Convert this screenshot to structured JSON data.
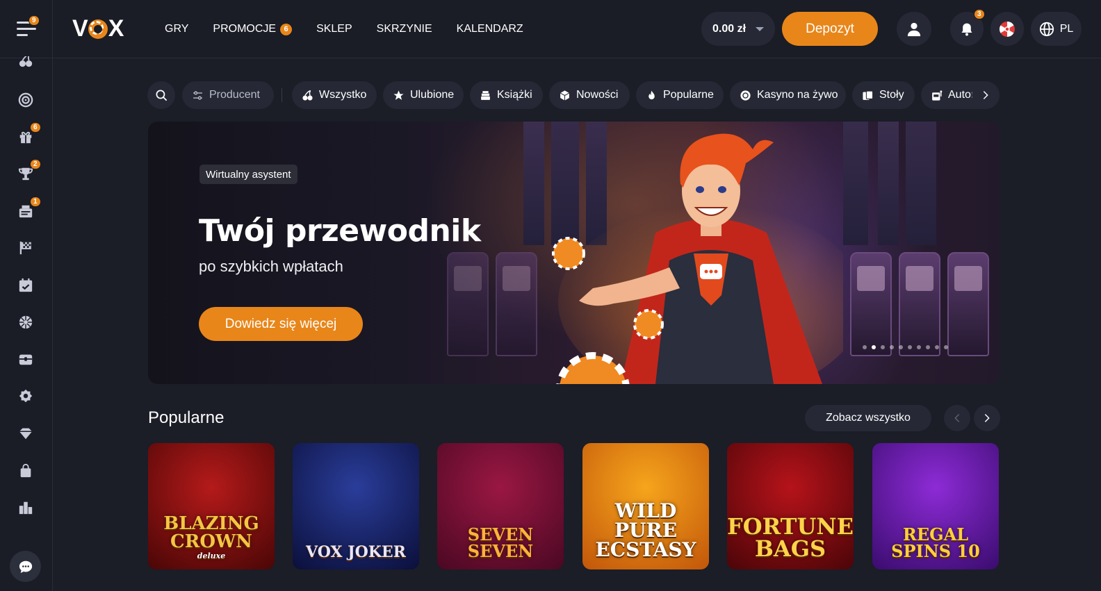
{
  "header": {
    "menu_badge": "9",
    "logo": "VOX",
    "nav": [
      {
        "label": "GRY"
      },
      {
        "label": "PROMOCJE",
        "badge": "6"
      },
      {
        "label": "SKLEP"
      },
      {
        "label": "SKRZYNIE"
      },
      {
        "label": "KALENDARZ"
      }
    ],
    "balance": "0.00 zł",
    "deposit_label": "Depozyt",
    "notifications_badge": "3",
    "language": "PL"
  },
  "sidebar": {
    "items": [
      {
        "icon": "cherries-icon"
      },
      {
        "icon": "target-icon"
      },
      {
        "icon": "gift-icon",
        "badge": "6"
      },
      {
        "icon": "trophy-icon",
        "badge": "2"
      },
      {
        "icon": "ticket-icon",
        "badge": "1"
      },
      {
        "icon": "race-flag-icon"
      },
      {
        "icon": "calendar-icon"
      },
      {
        "icon": "wheel-icon"
      },
      {
        "icon": "chest-icon"
      },
      {
        "icon": "badge-icon"
      },
      {
        "icon": "diamond-icon"
      },
      {
        "icon": "shopping-bag-icon"
      },
      {
        "icon": "leaderboard-icon"
      }
    ],
    "chat_icon": "chat-icon"
  },
  "filters": {
    "producer_label": "Producent",
    "chips": [
      {
        "label": "Wszystko",
        "icon": "cherries-icon"
      },
      {
        "label": "Ulubione",
        "icon": "star-icon"
      },
      {
        "label": "Książki",
        "icon": "books-icon"
      },
      {
        "label": "Nowości",
        "icon": "cube-icon"
      },
      {
        "label": "Popularne",
        "icon": "flame-icon"
      },
      {
        "label": "Kasyno na żywo",
        "icon": "chip-icon"
      },
      {
        "label": "Stoły",
        "icon": "cards-icon"
      },
      {
        "label": "Autor",
        "icon": "slot-icon"
      }
    ]
  },
  "hero": {
    "tag": "Wirtualny asystent",
    "title": "Twój przewodnik",
    "subtitle": "po szybkich wpłatach",
    "cta": "Dowiedz się więcej",
    "slide_count": 10,
    "active_slide": 2
  },
  "popular": {
    "title": "Popularne",
    "see_all": "Zobacz wszystko",
    "games": [
      {
        "name": "BLAZING CROWN",
        "sub": "deluxe",
        "bg1": "#b51a1a",
        "bg2": "#4a0606",
        "color": "#f5c542"
      },
      {
        "name": "VOX JOKER",
        "sub": "",
        "bg1": "#2a3d9a",
        "bg2": "#0b0f3a",
        "color": "#e9e6ff"
      },
      {
        "name": "SEVEN SEVEN",
        "sub": "",
        "bg1": "#9a1743",
        "bg2": "#4a0822",
        "color": "#ffb23a"
      },
      {
        "name": "WILD PURE ECSTASY",
        "sub": "",
        "bg1": "#f6a51c",
        "bg2": "#c2560a",
        "color": "#ffffff"
      },
      {
        "name": "FORTUNE BAGS",
        "sub": "",
        "bg1": "#b6131a",
        "bg2": "#4b0508",
        "color": "#ffd24a"
      },
      {
        "name": "REGAL SPINS 10",
        "sub": "",
        "bg1": "#8d2bd6",
        "bg2": "#3a0c6e",
        "color": "#ffcf3a"
      }
    ]
  },
  "colors": {
    "accent": "#e8861a",
    "background": "#1b1d27",
    "chip": "#262935"
  }
}
